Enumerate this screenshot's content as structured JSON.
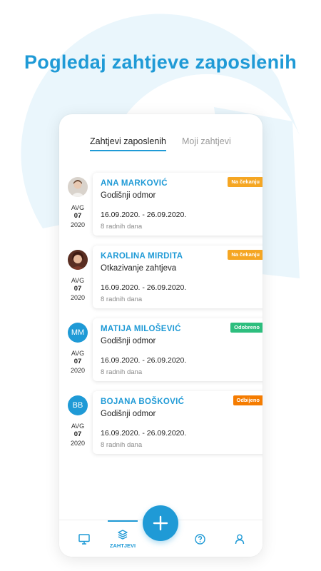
{
  "headline": "Pogledaj zahtjeve zaposlenih",
  "tabs": {
    "active": "Zahtjevi zaposlenih",
    "inactive": "Moji zahtjevi"
  },
  "colors": {
    "accent": "#1f9ad6",
    "pending": "#f5a623",
    "approved": "#2dbe7e",
    "rejected": "#f57c00",
    "background_arc": "#e9f5fb"
  },
  "requests": [
    {
      "name": "ANA MARKOVIĆ",
      "type": "Godišnji odmor",
      "range": "16.09.2020. - 26.09.2020.",
      "days": "8 radnih dana",
      "status": "Na čekanju",
      "status_color": "#f5a623",
      "avatar": "photo",
      "date": {
        "month": "AVG",
        "day": "07",
        "year": "2020"
      }
    },
    {
      "name": "KAROLINA MIRDITA",
      "type": "Otkazivanje zahtjeva",
      "range": "16.09.2020. - 26.09.2020.",
      "days": "8 radnih dana",
      "status": "Na čekanju",
      "status_color": "#f5a623",
      "avatar": "photo",
      "date": {
        "month": "AVG",
        "day": "07",
        "year": "2020"
      }
    },
    {
      "name": "MATIJA MILOŠEVIĆ",
      "type": "Godišnji odmor",
      "range": "16.09.2020. - 26.09.2020.",
      "days": "8 radnih dana",
      "status": "Odobreno",
      "status_color": "#2dbe7e",
      "avatar": "MM",
      "date": {
        "month": "AVG",
        "day": "07",
        "year": "2020"
      }
    },
    {
      "name": "BOJANA BOŠKOVIĆ",
      "type": "Godišnji odmor",
      "range": "16.09.2020. - 26.09.2020.",
      "days": "8 radnih dana",
      "status": "Odbijeno",
      "status_color": "#f57c00",
      "avatar": "BB",
      "date": {
        "month": "AVG",
        "day": "07",
        "year": "2020"
      }
    }
  ],
  "nav": {
    "items": [
      "monitor-icon",
      "layers-icon",
      "help-icon",
      "user-icon"
    ],
    "active_label": "ZAHTJEVI",
    "fab_icon": "plus-icon"
  }
}
